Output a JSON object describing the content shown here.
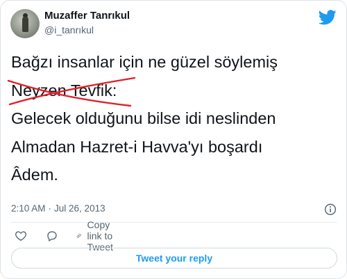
{
  "author": {
    "name": "Muzaffer Tanrıkul",
    "handle": "@i_tanrıkul"
  },
  "tweet": {
    "lines": [
      "Bağzı insanlar için ne güzel söylemiş",
      "Neyzen Tevfik:",
      "Gelecek olduğunu bilse idi neslinden",
      "Almadan Hazret-i Havva'yı boşardı",
      "Âdem."
    ],
    "strike_color": "#e0202a"
  },
  "meta": {
    "time": "2:10 AM",
    "date": "Jul 26, 2013",
    "separator": "·"
  },
  "actions": {
    "copy_link_label": "Copy link to Tweet"
  },
  "reply": {
    "label": "Tweet your reply"
  },
  "colors": {
    "brand": "#1d9bf0",
    "secondary_text": "#536471",
    "border": "#cfd9de"
  },
  "icons": [
    "avatar",
    "twitter-bird-icon",
    "info-icon",
    "heart-icon",
    "reply-icon",
    "link-icon"
  ]
}
